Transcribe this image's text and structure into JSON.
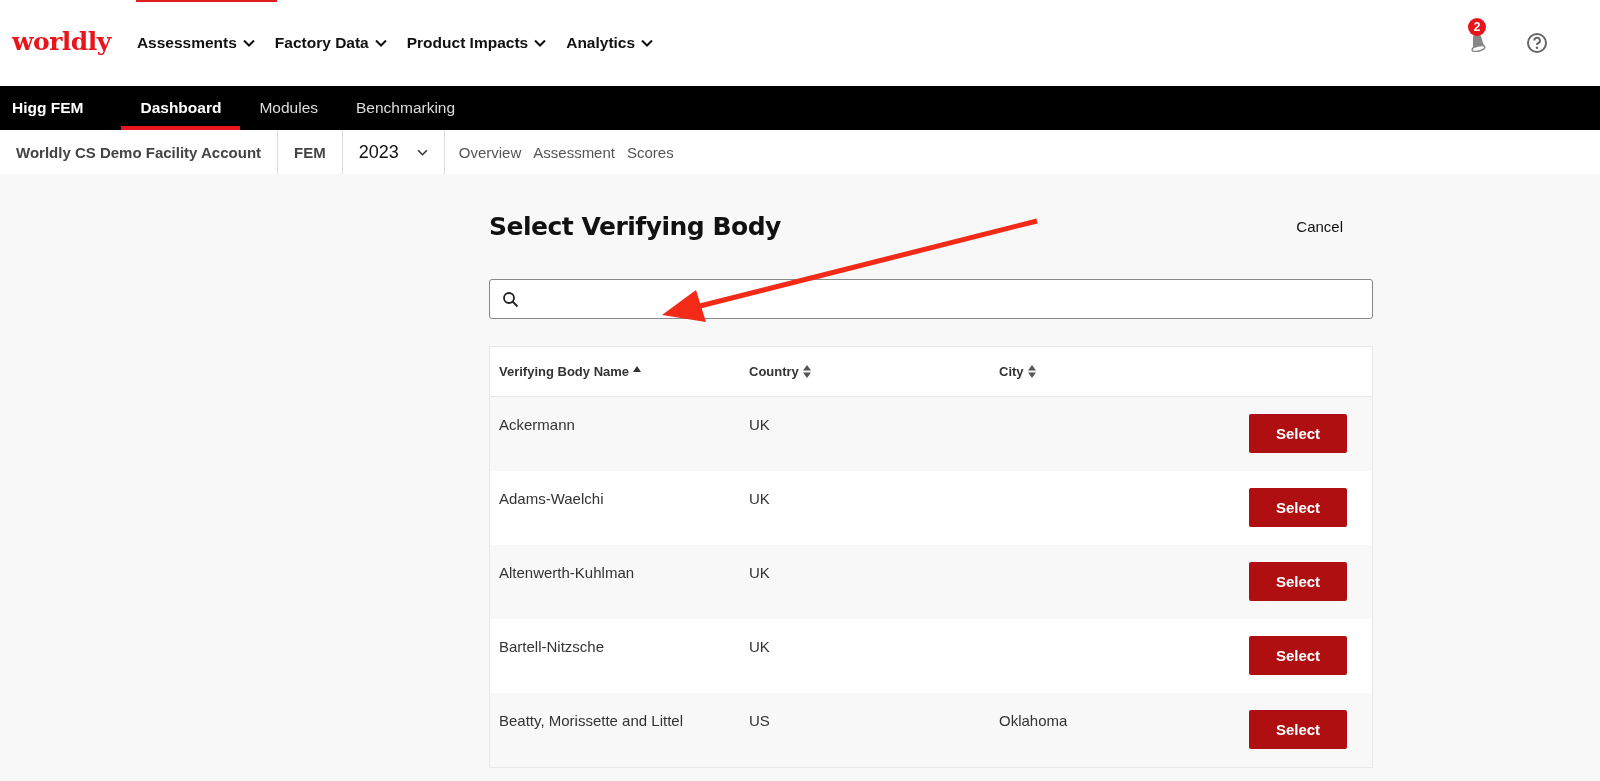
{
  "top_nav": {
    "logo": "worldly",
    "menus": [
      {
        "label": "Assessments"
      },
      {
        "label": "Factory Data"
      },
      {
        "label": "Product Impacts"
      },
      {
        "label": "Analytics"
      }
    ],
    "notification_count": "2"
  },
  "module_bar": {
    "title": "Higg FEM",
    "tabs": [
      {
        "label": "Dashboard",
        "selected": true
      },
      {
        "label": "Modules",
        "selected": false
      },
      {
        "label": "Benchmarking",
        "selected": false
      }
    ]
  },
  "context_bar": {
    "account": "Worldly CS Demo Facility Account",
    "module": "FEM",
    "year": "2023",
    "links": [
      {
        "label": "Overview"
      },
      {
        "label": "Assessment"
      },
      {
        "label": "Scores"
      }
    ]
  },
  "page": {
    "title": "Select Verifying Body",
    "cancel": "Cancel"
  },
  "table": {
    "columns": [
      {
        "label": "Verifying Body Name",
        "sorted": true
      },
      {
        "label": "Country",
        "sorted": false
      },
      {
        "label": "City",
        "sorted": false
      }
    ],
    "rows": [
      {
        "name": "Ackermann",
        "country": "UK",
        "action": "Select"
      },
      {
        "name": "Adams-Waelchi",
        "country": "UK",
        "action": "Select"
      },
      {
        "name": "Altenwerth-Kuhlman",
        "country": "UK",
        "action": "Select"
      },
      {
        "name": "Bartell-Nitzsche",
        "country": "UK",
        "action": "Select"
      },
      {
        "name": "Beatty, Morissette and Littel",
        "country": "US",
        "city": "Oklahoma",
        "action": "Select"
      }
    ]
  }
}
